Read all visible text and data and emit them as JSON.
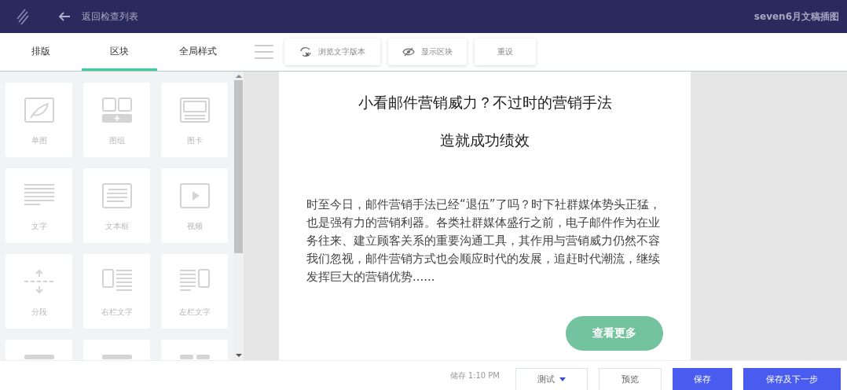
{
  "header": {
    "back_label": "返回检查列表",
    "document_title": "seven6月文稿插图"
  },
  "tabs": [
    {
      "label": "排版",
      "selected": false
    },
    {
      "label": "区块",
      "selected": true
    },
    {
      "label": "全局样式",
      "selected": false
    }
  ],
  "toolbar": [
    {
      "kind": "text-version",
      "label": "浏览文字版本"
    },
    {
      "kind": "show-blocks",
      "label": "显示区块"
    },
    {
      "kind": "reset",
      "label": "重设"
    }
  ],
  "blocks": [
    {
      "kind": "single-image",
      "label": "单图"
    },
    {
      "kind": "image-group",
      "label": "图组"
    },
    {
      "kind": "image-card",
      "label": "图卡"
    },
    {
      "kind": "text",
      "label": "文字"
    },
    {
      "kind": "text-box",
      "label": "文本框"
    },
    {
      "kind": "video",
      "label": "视频"
    },
    {
      "kind": "divider",
      "label": "分段"
    },
    {
      "kind": "right-text",
      "label": "右栏文字"
    },
    {
      "kind": "left-text",
      "label": "左栏文字"
    },
    {
      "kind": "bar"
    },
    {
      "kind": "bar"
    },
    {
      "kind": "double-bar"
    }
  ],
  "preview": {
    "title_lines": [
      "小看邮件营销威力？不过时的营销手法",
      "造就成功绩效"
    ],
    "body": "时至今日，邮件营销手法已经“退伍”了吗？时下社群媒体势头正猛，也是强有力的营销利器。各类社群媒体盛行之前，电子邮件作为在业务往来、建立顾客关系的重要沟通工具，其作用与营销威力仍然不容我们忽视，邮件营销方式也会顺应时代的发展，追赶时代潮流，继续发挥巨大的营销优势......",
    "button": "查看更多"
  },
  "footer": {
    "saved": "储存 1:10 PM",
    "test": "测试",
    "preview": "预览",
    "save": "保存",
    "save_next": "保存及下一步"
  }
}
